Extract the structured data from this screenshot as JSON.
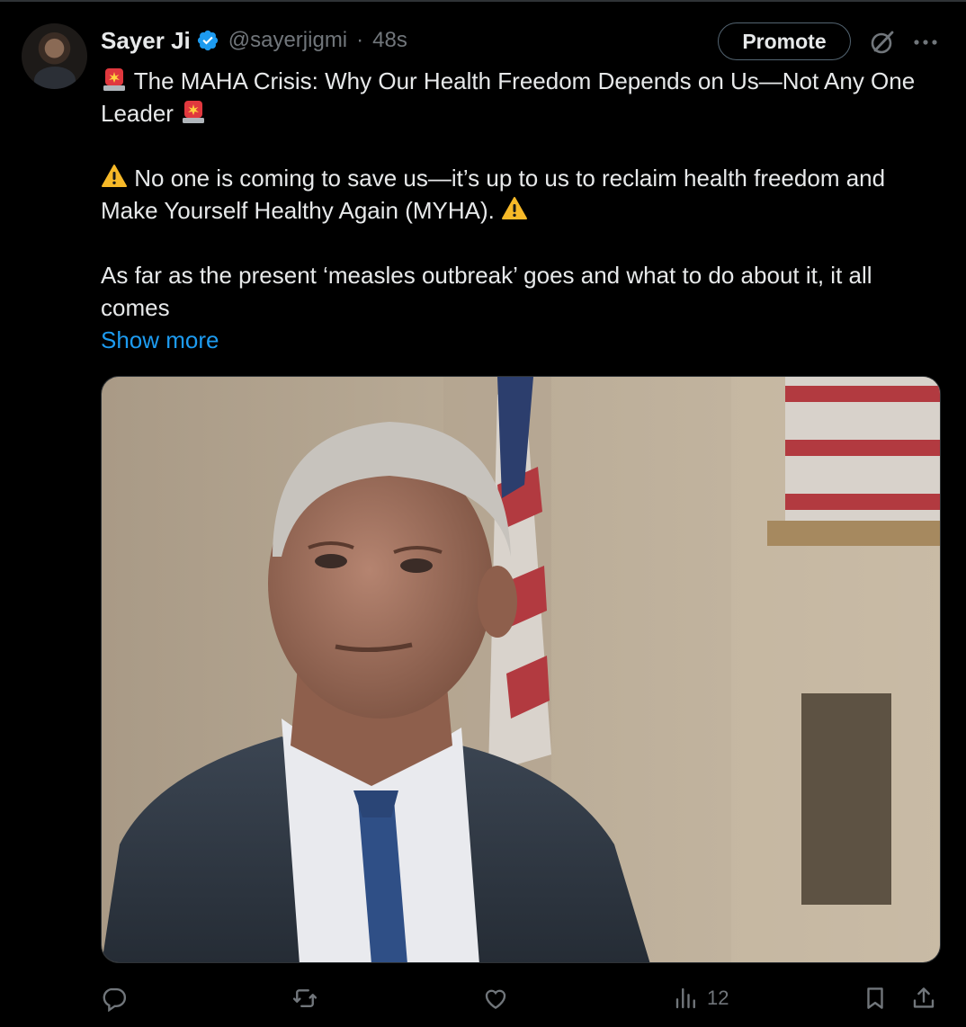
{
  "tweet": {
    "author_name": "Sayer Ji",
    "handle": "@sayerjigmi",
    "separator": "·",
    "time": "48s",
    "promote_label": "Promote",
    "line1": "The MAHA Crisis: Why Our Health Freedom Depends on Us—Not Any One Leader",
    "line2": "No one is coming to save us—it’s up to us to reclaim health freedom and Make Yourself Healthy Again (MYHA).",
    "line3": "As far as the present ‘measles outbreak’ goes and what to do about it, it all comes",
    "show_more": "Show more"
  },
  "icons": {
    "verified": "verified-badge-icon",
    "grok": "grok-icon",
    "more": "more-icon",
    "siren": "police-light-emoji",
    "warning": "warning-emoji",
    "reply": "reply-icon",
    "retweet": "retweet-icon",
    "like": "like-icon",
    "views": "views-icon",
    "bookmark": "bookmark-icon",
    "share": "share-icon"
  },
  "actions": {
    "views_count": "12"
  },
  "colors": {
    "background": "#000000",
    "text": "#e7e9ea",
    "secondary": "#71767b",
    "link": "#1d9bf0",
    "verified": "#1d9bf0"
  }
}
